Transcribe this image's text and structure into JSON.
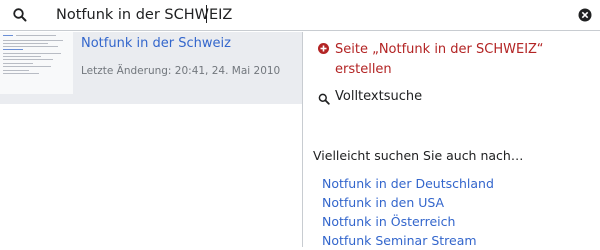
{
  "search": {
    "value": "Notfunk in der SCHWEIZ",
    "icon": "search-icon",
    "clear_icon": "clear-icon"
  },
  "results": [
    {
      "title": "Notfunk in der Schweiz",
      "meta": "Letzte Änderung: 20:41, 24. Mai 2010"
    }
  ],
  "create_page": {
    "icon": "add-circle-icon",
    "label": "Seite „Notfunk in der SCHWEIZ“ erstellen",
    "color": "#b32424"
  },
  "fulltext": {
    "icon": "search-icon",
    "label": "Volltextsuche"
  },
  "suggestions": {
    "heading": "Vielleicht suchen Sie auch nach…",
    "items": [
      "Notfunk in der Deutschland",
      "Notfunk in den USA",
      "Notfunk in Österreich",
      "Notfunk Seminar Stream"
    ]
  },
  "colors": {
    "link": "#3366cc",
    "selected_row": "#eaecf0",
    "divider": "#c8ccd1"
  }
}
